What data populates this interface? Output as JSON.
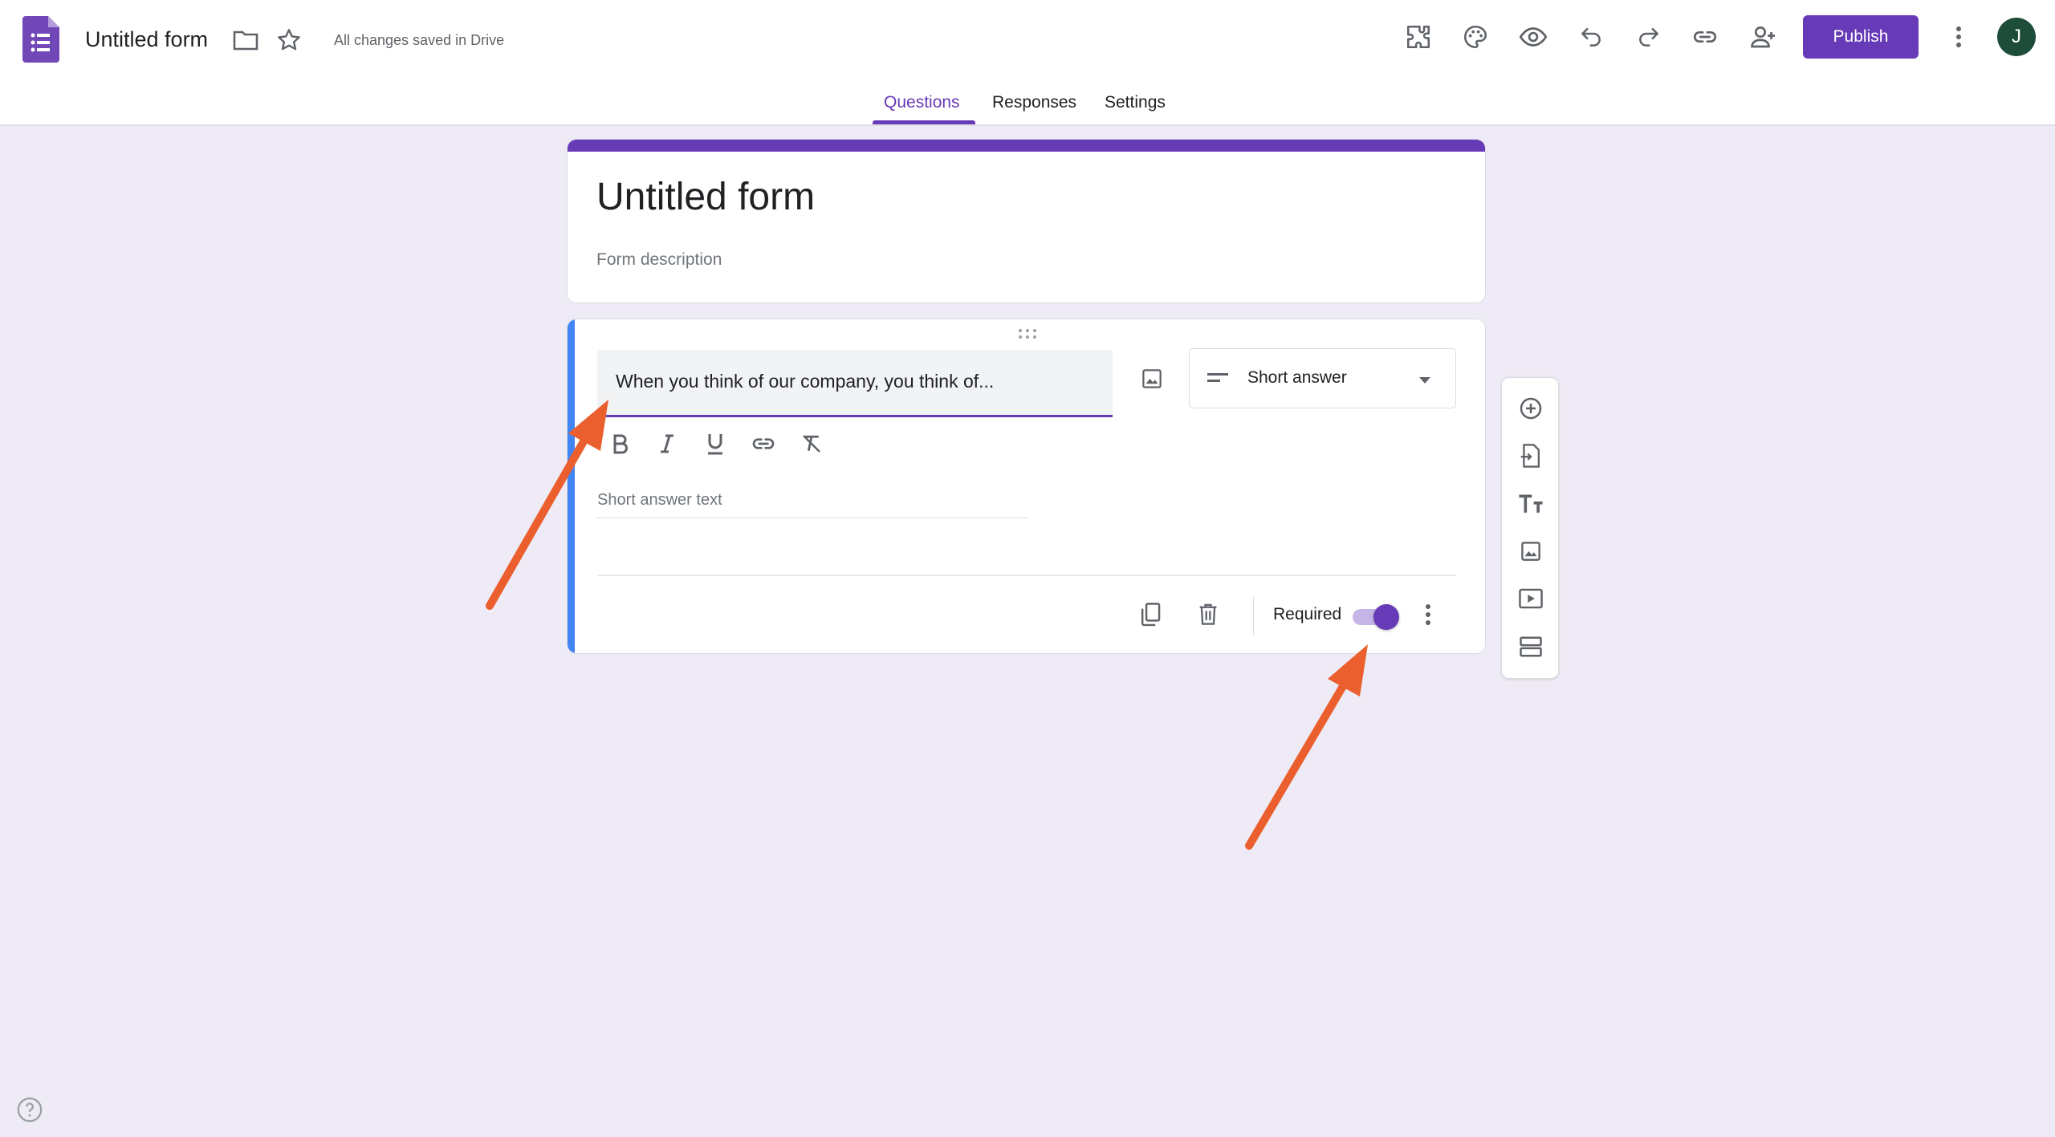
{
  "header": {
    "doc_title": "Untitled form",
    "save_status": "All changes saved in Drive",
    "publish_label": "Publish",
    "avatar_initial": "J",
    "icons": [
      "addons-icon",
      "palette-icon",
      "preview-icon",
      "undo-icon",
      "redo-icon",
      "link-icon",
      "add-collaborator-icon",
      "more-vert-icon"
    ]
  },
  "tabs": [
    {
      "label": "Questions",
      "active": true
    },
    {
      "label": "Responses",
      "active": false
    },
    {
      "label": "Settings",
      "active": false
    }
  ],
  "form": {
    "title": "Untitled form",
    "description_placeholder": "Form description"
  },
  "question": {
    "text": "When you think of our company, you think of...",
    "type": "Short answer",
    "answer_placeholder": "Short answer text",
    "required_label": "Required",
    "required": true
  },
  "side_toolbar": [
    "add-question-icon",
    "import-questions-icon",
    "add-title-icon",
    "add-image-icon",
    "add-video-icon",
    "add-section-icon"
  ],
  "colors": {
    "accent": "#673ab7",
    "question_bar": "#4285f4",
    "background": "#efebf6",
    "annotation_arrow": "#ea5f2d"
  }
}
